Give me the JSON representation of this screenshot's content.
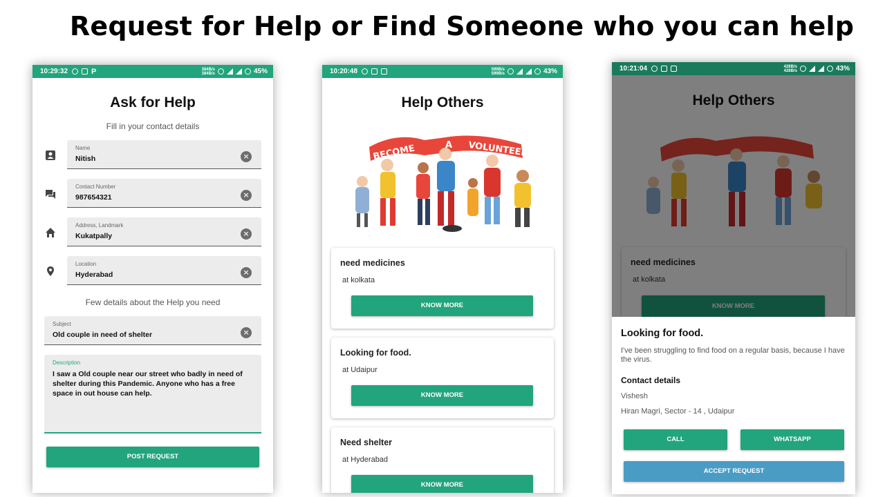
{
  "slide": {
    "title": "Request for Help or Find Someone who you can help"
  },
  "phone1": {
    "status": {
      "time": "10:29:32",
      "speed_up": "384B/s",
      "speed_down": "384B/s",
      "battery": "45%"
    },
    "title": "Ask for Help",
    "subtitle": "Fill in your contact details",
    "fields": [
      {
        "label": "Name",
        "value": "Nitish",
        "icon": "person-icon"
      },
      {
        "label": "Contact Number",
        "value": "987654321",
        "icon": "chat-icon"
      },
      {
        "label": "Address, Landmark",
        "value": "Kukatpally",
        "icon": "home-icon"
      },
      {
        "label": "Location",
        "value": "Hyderabad",
        "icon": "location-pin-icon"
      }
    ],
    "section2": "Few details about the Help you need",
    "subject": {
      "label": "Subject",
      "value": "Old couple in need of shelter"
    },
    "description": {
      "label": "Description",
      "value": "I saw a Old couple near our street who badly in need of shelter during this Pandemic. Anyone who has a free space in out house can help."
    },
    "post_button": "POST REQUEST"
  },
  "phone2": {
    "status": {
      "time": "10:20:48",
      "speed_up": "599B/s",
      "speed_down": "599B/s",
      "battery": "43%"
    },
    "title": "Help Others",
    "banner": {
      "left": "BECOME",
      "mid": "A",
      "right": "VOLUNTEER"
    },
    "cards": [
      {
        "title": "need medicines",
        "location": "at kolkata",
        "button": "KNOW MORE"
      },
      {
        "title": "Looking for food.",
        "location": "at Udaipur",
        "button": "KNOW MORE"
      },
      {
        "title": "Need shelter",
        "location": "at Hyderabad",
        "button": "KNOW MORE"
      }
    ]
  },
  "phone3": {
    "status": {
      "time": "10:21:04",
      "speed_up": "428B/s",
      "speed_down": "428B/s",
      "battery": "43%"
    },
    "title": "Help Others",
    "card": {
      "title": "need medicines",
      "location": "at kolkata",
      "button": "KNOW MORE"
    },
    "sheet": {
      "title": "Looking for food.",
      "description": "I've been struggling to find food on a regular basis, because I have the virus.",
      "contact_heading": "Contact details",
      "name": "Vishesh",
      "address": "Hiran Magri, Sector - 14 , Udaipur",
      "call_button": "CALL",
      "whatsapp_button": "WHATSAPP",
      "accept_button": "ACCEPT REQUEST"
    }
  },
  "colors": {
    "primary": "#22a47c",
    "accept": "#4a9cc4",
    "field_bg": "#ececec"
  }
}
